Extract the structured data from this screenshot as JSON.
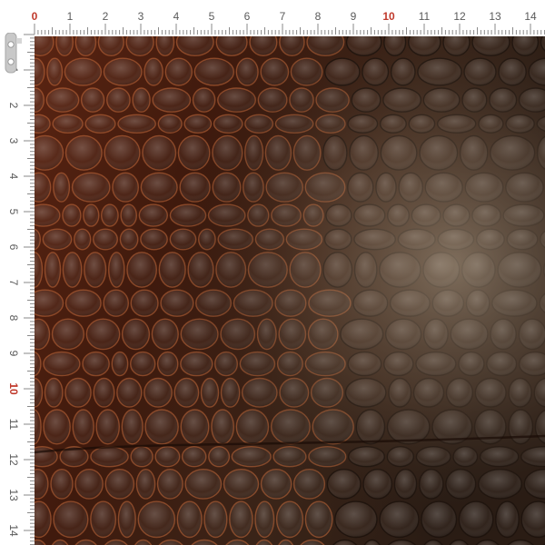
{
  "ruler": {
    "unit_labels": [
      "0",
      "1",
      "2",
      "3",
      "4",
      "5",
      "6",
      "7",
      "8",
      "9",
      "10",
      "11",
      "12",
      "13",
      "14"
    ],
    "highlight_labels": [
      "0",
      "10"
    ],
    "label_color": "#5a5a5a",
    "highlight_color": "#c0392b",
    "tick_color": "#8a8a8a",
    "background": "#ffffff"
  },
  "clamp": {
    "color": "#c8c8c8",
    "icon": "ruler-clamp-icon"
  },
  "fabric": {
    "texture": "crocodile-leather",
    "base_color": "#3a1a0e",
    "highlight_color": "#b9a890",
    "edge_color": "#c46a3a"
  }
}
